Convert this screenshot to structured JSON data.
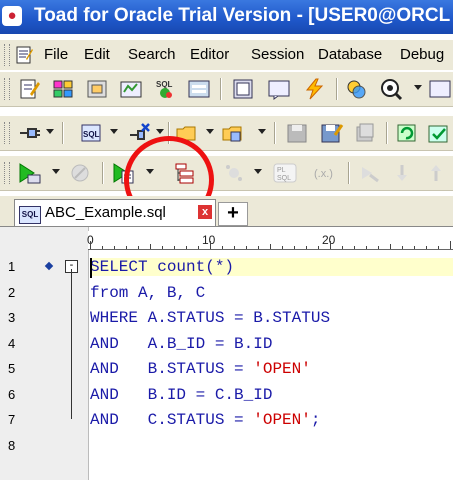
{
  "window": {
    "title": "Toad for Oracle Trial Version - [USER0@ORCL",
    "app_icon": "toad-app-icon",
    "title_color": "#1e56c8"
  },
  "menubar": {
    "items": [
      "File",
      "Edit",
      "Search",
      "Editor",
      "Session",
      "Database",
      "Debug"
    ]
  },
  "toolbar1": {
    "icons": [
      "new-editor-icon",
      "schema-browser-icon",
      "sql-recall-icon",
      "project-manager-icon",
      "sql-modeler-icon",
      "session-browser-icon",
      "window-icon",
      "output-icon",
      "quick-action-icon",
      "compare-icon",
      "query-builder-icon"
    ]
  },
  "toolbar2": {
    "icons": [
      "connect-icon",
      "sql-file-icon",
      "disconnect-icon",
      "open-folder-icon",
      "new-window-icon",
      "save-icon",
      "save-as-icon",
      "print-icon",
      "refresh-icon"
    ],
    "sql_icon_text": "SQL"
  },
  "toolbar3": {
    "icons": [
      "execute-statement-icon",
      "stop-icon",
      "execute-script-icon",
      "explain-plan-icon",
      "debug-icon",
      "plsql-icon",
      "format-icon",
      "step-icons"
    ],
    "plsql_icon_text": "PL SQL",
    "fx_icon_text": "(.x.)"
  },
  "highlight": {
    "color": "#e11111",
    "target": "explain-plan-icon"
  },
  "tabs": {
    "active_label": "ABC_Example.sql",
    "sql_icon_text": "SQL",
    "close_symbol": "x",
    "new_tab_symbol": "+"
  },
  "ruler": {
    "marks": [
      "0",
      "10",
      "20"
    ]
  },
  "editor": {
    "lines": [
      {
        "number": "1",
        "parts": [
          {
            "t": "SELECT count(*)",
            "k": "kw"
          }
        ]
      },
      {
        "number": "2",
        "parts": [
          {
            "t": "from A, B, C",
            "k": "kw"
          }
        ]
      },
      {
        "number": "3",
        "parts": [
          {
            "t": "WHERE A.STATUS = B.STATUS",
            "k": "kw"
          }
        ]
      },
      {
        "number": "4",
        "parts": [
          {
            "t": "AND   A.B_ID = B.ID",
            "k": "kw"
          }
        ]
      },
      {
        "number": "5",
        "parts": [
          {
            "t": "AND   B.STATUS = ",
            "k": "kw"
          },
          {
            "t": "'OPEN'",
            "k": "str"
          }
        ]
      },
      {
        "number": "6",
        "parts": [
          {
            "t": "AND   B.ID = C.B_ID",
            "k": "kw"
          }
        ]
      },
      {
        "number": "7",
        "parts": [
          {
            "t": "AND   C.STATUS = ",
            "k": "kw"
          },
          {
            "t": "'OPEN'",
            "k": "str"
          },
          {
            "t": ";",
            "k": "kw"
          }
        ]
      },
      {
        "number": "8",
        "parts": []
      }
    ],
    "fold_symbol": "-",
    "keyword_color": "#1a1aa8",
    "string_color": "#cc0000",
    "current_line_bg": "#ffffcc"
  }
}
